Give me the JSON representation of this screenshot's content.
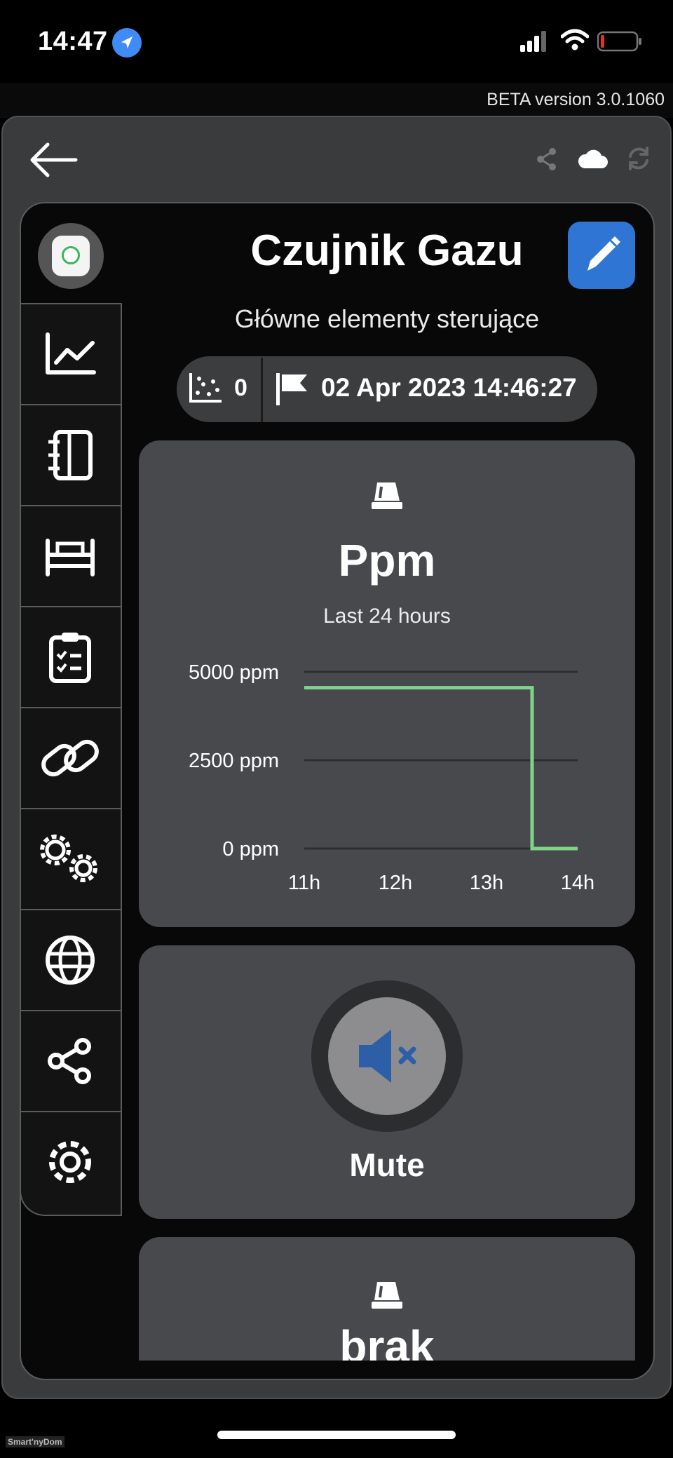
{
  "status_bar": {
    "time": "14:47"
  },
  "app": {
    "beta_label": "BETA version 3.0.1060"
  },
  "device": {
    "name": "Czujnik Gazu",
    "section": "Główne elementy sterujące"
  },
  "info": {
    "count": "0",
    "timestamp": "02 Apr 2023 14:46:27"
  },
  "sidebar": {
    "items": [
      {
        "icon": "chart-line-icon"
      },
      {
        "icon": "notebook-icon"
      },
      {
        "icon": "bed-icon"
      },
      {
        "icon": "clipboard-check-icon"
      },
      {
        "icon": "link-icon"
      },
      {
        "icon": "gears-icon"
      },
      {
        "icon": "globe-icon"
      },
      {
        "icon": "share-nodes-icon"
      },
      {
        "icon": "settings-gear-icon"
      }
    ]
  },
  "ppm_card": {
    "title": "Ppm",
    "subtitle": "Last 24 hours"
  },
  "chart_data": {
    "type": "line",
    "y_tick_labels": [
      "5000 ppm",
      "2500 ppm",
      "0 ppm"
    ],
    "x_tick_labels": [
      "11h",
      "12h",
      "13h",
      "14h"
    ],
    "ylim": [
      0,
      5000
    ],
    "xlim": [
      11,
      14
    ],
    "grid": true,
    "series": [
      {
        "color": "#7fd38b",
        "step": true,
        "points": [
          [
            11,
            4550
          ],
          [
            13.5,
            4550
          ],
          [
            13.5,
            0
          ],
          [
            14,
            0
          ]
        ]
      }
    ]
  },
  "mute_card": {
    "label": "Mute"
  },
  "brak_card": {
    "title": "brak"
  },
  "footer": {
    "watermark": "Smart'nyDom"
  },
  "colors": {
    "accent": "#2f76d4",
    "line": "#7fd38b",
    "card": "#47494c"
  }
}
